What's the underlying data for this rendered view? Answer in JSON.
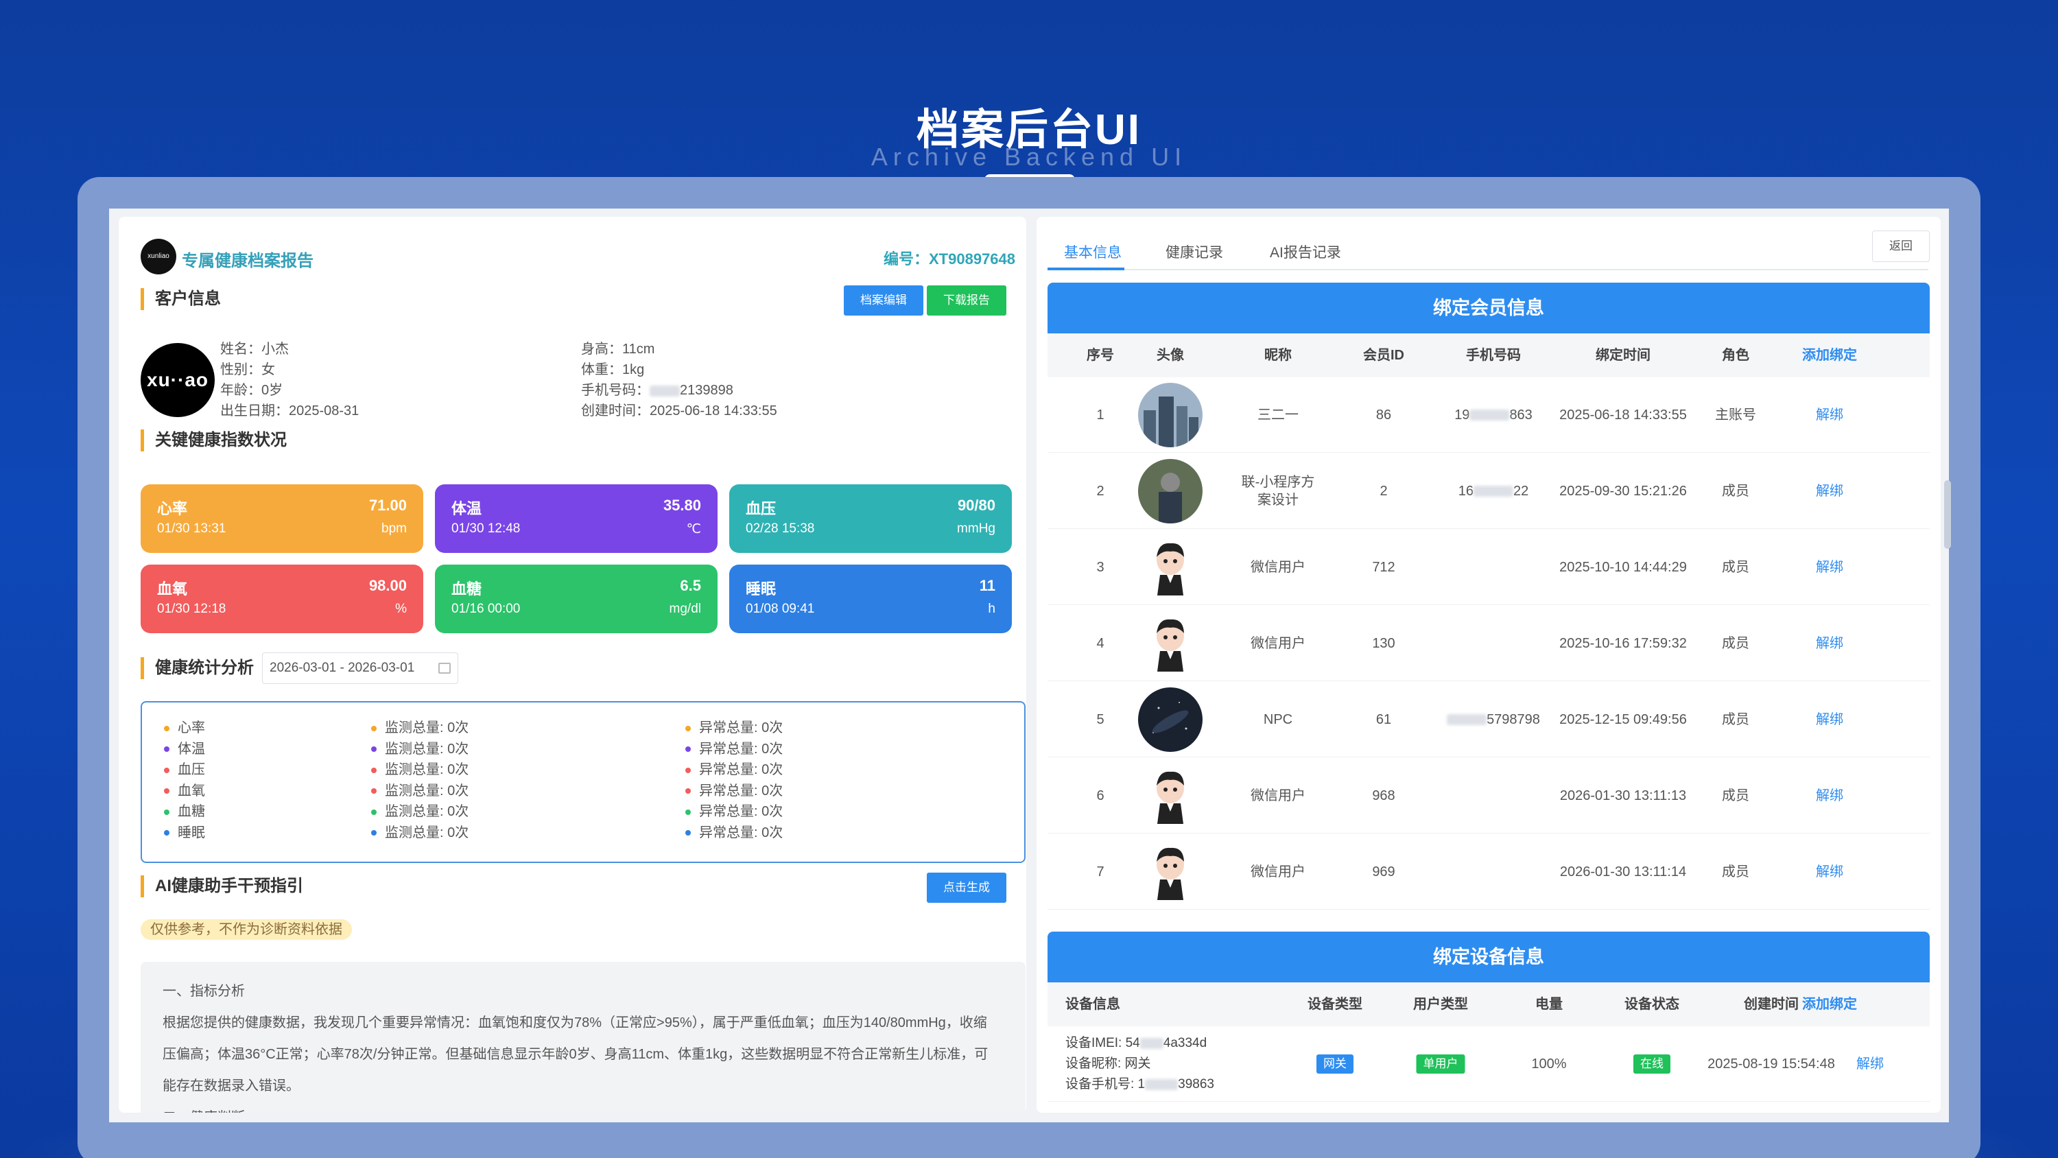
{
  "hero": {
    "title": "档案后台UI",
    "subtitle": "Archive Backend UI"
  },
  "report": {
    "logo_text": "xunliao",
    "title": "专属健康档案报告",
    "number": "编号：XT90897648"
  },
  "customer": {
    "section": "客户信息",
    "btn_edit": "档案编辑",
    "btn_download": "下载报告",
    "avatar_text": "xu··ao",
    "name": "姓名：小杰",
    "gender": "性别：女",
    "age": "年龄：0岁",
    "birth": "出生日期：2025-08-31",
    "height": "身高：11cm",
    "weight": "体重：1kg",
    "phone_prefix": "手机号码：",
    "phone_suffix": "2139898",
    "created": "创建时间：2025-06-18 14:33:55"
  },
  "indicators": {
    "section": "关键健康指数状况",
    "cards": [
      {
        "name": "心率",
        "value": "71.00",
        "date": "01/30 13:31",
        "unit": "bpm",
        "color": "#f7aa3c"
      },
      {
        "name": "体温",
        "value": "35.80",
        "date": "01/30 12:48",
        "unit": "℃",
        "color": "#7a45e6"
      },
      {
        "name": "血压",
        "value": "90/80",
        "date": "02/28 15:38",
        "unit": "mmHg",
        "color": "#2fb2b3"
      },
      {
        "name": "血氧",
        "value": "98.00",
        "date": "01/30 12:18",
        "unit": "%",
        "color": "#f25c5c"
      },
      {
        "name": "血糖",
        "value": "6.5",
        "date": "01/16 00:00",
        "unit": "mg/dl",
        "color": "#2cc36b"
      },
      {
        "name": "睡眠",
        "value": "11",
        "date": "01/08 09:41",
        "unit": "h",
        "color": "#2d7fe3"
      }
    ]
  },
  "stats": {
    "section": "健康统计分析",
    "date_range": "2026-03-01 - 2026-03-01",
    "rows": [
      {
        "name": "心率",
        "total": "监测总量: 0次",
        "abnormal": "异常总量: 0次",
        "color": "#f5a623"
      },
      {
        "name": "体温",
        "total": "监测总量: 0次",
        "abnormal": "异常总量: 0次",
        "color": "#7a45e6"
      },
      {
        "name": "血压",
        "total": "监测总量: 0次",
        "abnormal": "异常总量: 0次",
        "color": "#f25c5c"
      },
      {
        "name": "血氧",
        "total": "监测总量: 0次",
        "abnormal": "异常总量: 0次",
        "color": "#f25c5c"
      },
      {
        "name": "血糖",
        "total": "监测总量: 0次",
        "abnormal": "异常总量: 0次",
        "color": "#2cc36b"
      },
      {
        "name": "睡眠",
        "total": "监测总量: 0次",
        "abnormal": "异常总量: 0次",
        "color": "#2d7fe3"
      }
    ]
  },
  "ai": {
    "section": "AI健康助手干预指引",
    "btn_generate": "点击生成",
    "warning": "仅供参考，不作为诊断资料依据",
    "heading": "一、指标分析",
    "line1": "根据您提供的健康数据，我发现几个重要异常情况：血氧饱和度仅为78%（正常应>95%），属于严重低血氧；血压为140/80mmHg，收缩",
    "line2": "压偏高；体温36°C正常；心率78次/分钟正常。但基础信息显示年龄0岁、身高11cm、体重1kg，这些数据明显不符合正常新生儿标准，可",
    "line3": "能存在数据录入错误。",
    "line4": "二、健康判断"
  },
  "tabs": {
    "items": [
      "基本信息",
      "健康记录",
      "AI报告记录"
    ],
    "back": "返回"
  },
  "members": {
    "title": "绑定会员信息",
    "headers": [
      "序号",
      "头像",
      "昵称",
      "会员ID",
      "手机号码",
      "绑定时间",
      "角色",
      "添加绑定"
    ],
    "rows": [
      {
        "no": "1",
        "avatar": "city",
        "nick": "三二一",
        "id": "86",
        "phone_a": "19",
        "phone_b": "863",
        "time": "2025-06-18 14:33:55",
        "role": "主账号",
        "action": "解绑"
      },
      {
        "no": "2",
        "avatar": "person",
        "nick": "联-小程序方案设计",
        "id": "2",
        "phone_a": "16",
        "phone_b": "22",
        "time": "2025-09-30 15:21:26",
        "role": "成员",
        "action": "解绑"
      },
      {
        "no": "3",
        "avatar": "cartoon",
        "nick": "微信用户",
        "id": "712",
        "phone_a": "",
        "phone_b": "",
        "time": "2025-10-10 14:44:29",
        "role": "成员",
        "action": "解绑"
      },
      {
        "no": "4",
        "avatar": "cartoon",
        "nick": "微信用户",
        "id": "130",
        "phone_a": "",
        "phone_b": "",
        "time": "2025-10-16 17:59:32",
        "role": "成员",
        "action": "解绑"
      },
      {
        "no": "5",
        "avatar": "galaxy",
        "nick": "NPC",
        "id": "61",
        "phone_a": "",
        "phone_b": "5798798",
        "time": "2025-12-15 09:49:56",
        "role": "成员",
        "action": "解绑"
      },
      {
        "no": "6",
        "avatar": "cartoon",
        "nick": "微信用户",
        "id": "968",
        "phone_a": "",
        "phone_b": "",
        "time": "2026-01-30 13:11:13",
        "role": "成员",
        "action": "解绑"
      },
      {
        "no": "7",
        "avatar": "cartoon",
        "nick": "微信用户",
        "id": "969",
        "phone_a": "",
        "phone_b": "",
        "time": "2026-01-30 13:11:14",
        "role": "成员",
        "action": "解绑"
      }
    ]
  },
  "devices": {
    "title": "绑定设备信息",
    "headers": [
      "设备信息",
      "设备类型",
      "用户类型",
      "电量",
      "设备状态",
      "创建时间",
      "添加绑定"
    ],
    "row": {
      "imei_a": "设备IMEI: 54",
      "imei_b": "4a334d",
      "nick": "设备昵称: 网关",
      "phone_a": "设备手机号: 1",
      "phone_b": "39863",
      "type": "网关",
      "user_type": "单用户",
      "battery": "100%",
      "status": "在线",
      "time": "2025-08-19 15:54:48",
      "action": "解绑"
    }
  }
}
